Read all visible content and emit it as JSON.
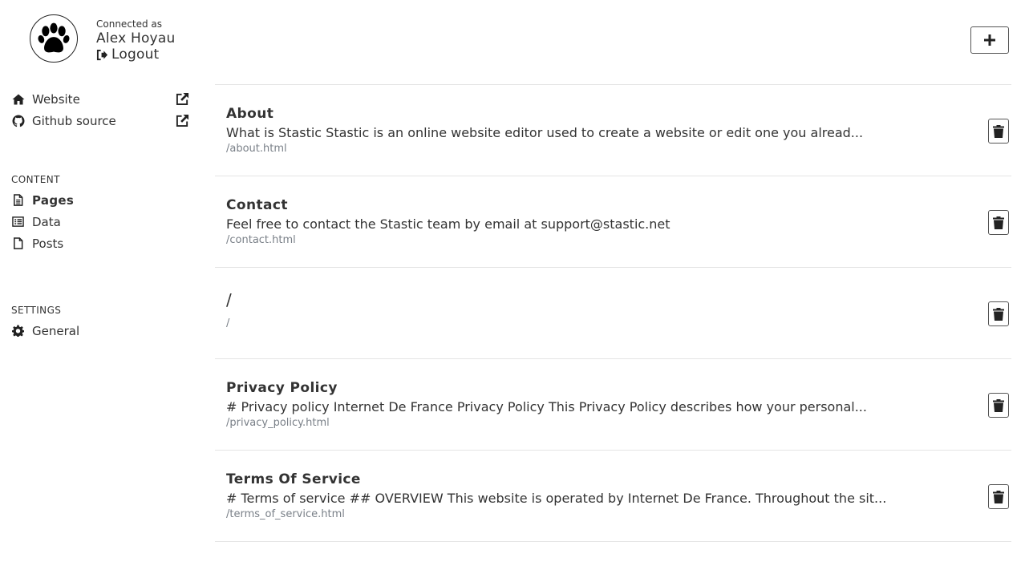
{
  "user": {
    "connected_as_label": "Connected as",
    "name": "Alex Hoyau",
    "logout_label": "Logout",
    "avatar_icon": "paw-icon"
  },
  "nav_links": [
    {
      "label": "Website",
      "icon": "home-icon",
      "external_icon": "external-link-icon"
    },
    {
      "label": "Github source",
      "icon": "github-icon",
      "external_icon": "external-link-icon"
    }
  ],
  "content_section": {
    "title": "CONTENT",
    "items": [
      {
        "label": "Pages",
        "icon": "file-text-icon",
        "active": true
      },
      {
        "label": "Data",
        "icon": "list-icon",
        "active": false
      },
      {
        "label": "Posts",
        "icon": "file-icon",
        "active": false
      }
    ]
  },
  "settings_section": {
    "title": "SETTINGS",
    "items": [
      {
        "label": "General",
        "icon": "gear-icon"
      }
    ]
  },
  "toolbar": {
    "add_icon": "plus-icon"
  },
  "pages": [
    {
      "title": "About",
      "excerpt": "What is Stastic Stastic is an online website editor used to create a website or edit one you alread...",
      "path": "/about.html"
    },
    {
      "title": "Contact",
      "excerpt": "Feel free to contact the Stastic team by email at support@stastic.net",
      "path": "/contact.html"
    },
    {
      "title": "/",
      "excerpt": "",
      "path": "/"
    },
    {
      "title": "Privacy Policy",
      "excerpt": "# Privacy policy Internet De France Privacy Policy This Privacy Policy describes how your personal...",
      "path": "/privacy_policy.html"
    },
    {
      "title": "Terms Of Service",
      "excerpt": "# Terms of service ## OVERVIEW This website is operated by Internet De France. Throughout the sit...",
      "path": "/terms_of_service.html"
    }
  ],
  "colors": {
    "text": "#333333",
    "muted": "#7a8088",
    "divider": "#e4e4e4"
  }
}
